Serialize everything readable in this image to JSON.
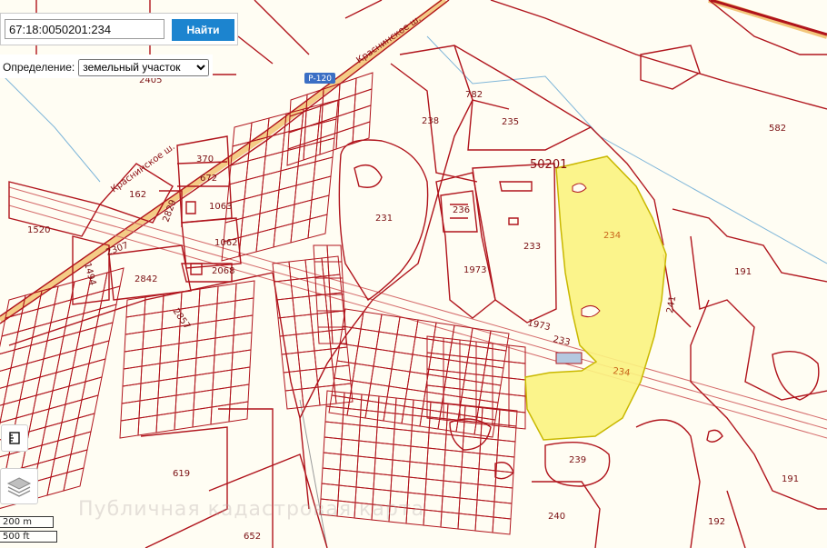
{
  "search": {
    "value": "67:18:0050201:234",
    "button_label": "Найти"
  },
  "definition": {
    "label": "Определение:",
    "selected": "земельный участок"
  },
  "block_number": "50201",
  "road_badge": "Р-120",
  "streets": [
    "Краснинское ш.",
    "Краснинское ш."
  ],
  "parcels": {
    "p2405": "2405",
    "p782": "782",
    "p238": "238",
    "p235": "235",
    "p582": "582",
    "p370": "370",
    "p672": "672",
    "p162": "162",
    "p1063": "1063",
    "p2829": "2829",
    "p1520": "1520",
    "p231": "231",
    "p236": "236",
    "p233": "233",
    "p1062": "1062",
    "p2307": "2307",
    "p1494": "1494",
    "p2842": "2842",
    "p2068": "2068",
    "p1973": "1973",
    "p191a": "191",
    "p2857": "2857",
    "p241": "241",
    "p1973b": "1973",
    "p233b": "233",
    "p234b": "234",
    "p239": "239",
    "p619": "619",
    "p191b": "191",
    "p240": "240",
    "p192": "192",
    "p652": "652"
  },
  "selected_parcel": {
    "label": "234",
    "fill": "#fbf37f",
    "stroke": "#c9b800"
  },
  "scale": {
    "metric": "200 m",
    "imperial": "500 ft"
  },
  "watermark": "Публичная кадастровая карта",
  "colors": {
    "line": "#b0141c",
    "background": "#fffdf3",
    "button": "#1c84cf"
  }
}
